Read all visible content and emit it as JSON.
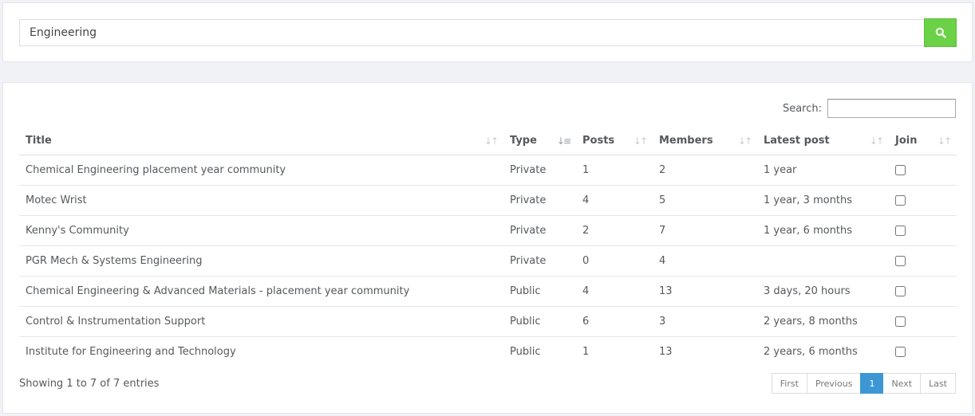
{
  "top_search": {
    "value": "Engineering"
  },
  "table_search": {
    "label": "Search:"
  },
  "table": {
    "columns": [
      "Title",
      "Type",
      "Posts",
      "Members",
      "Latest post",
      "Join"
    ],
    "rows": [
      {
        "title": "Chemical Engineering placement year community",
        "type": "Private",
        "posts": "1",
        "members": "2",
        "latest": "1 year"
      },
      {
        "title": "Motec Wrist",
        "type": "Private",
        "posts": "4",
        "members": "5",
        "latest": "1 year, 3 months"
      },
      {
        "title": "Kenny's Community",
        "type": "Private",
        "posts": "2",
        "members": "7",
        "latest": "1 year, 6 months"
      },
      {
        "title": "PGR Mech & Systems Engineering",
        "type": "Private",
        "posts": "0",
        "members": "4",
        "latest": ""
      },
      {
        "title": "Chemical Engineering & Advanced Materials - placement year community",
        "type": "Public",
        "posts": "4",
        "members": "13",
        "latest": "3 days, 20 hours"
      },
      {
        "title": "Control & Instrumentation Support",
        "type": "Public",
        "posts": "6",
        "members": "3",
        "latest": "2 years, 8 months"
      },
      {
        "title": "Institute for Engineering and Technology",
        "type": "Public",
        "posts": "1",
        "members": "13",
        "latest": "2 years, 6 months"
      }
    ]
  },
  "info": "Showing 1 to 7 of 7 entries",
  "pagination": {
    "first": "First",
    "previous": "Previous",
    "current": "1",
    "next": "Next",
    "last": "Last"
  },
  "colors": {
    "search_button": "#6bd146",
    "current_page": "#3c97d4"
  },
  "icons": {
    "search_button": "search-icon",
    "sort": "sort-icon"
  }
}
